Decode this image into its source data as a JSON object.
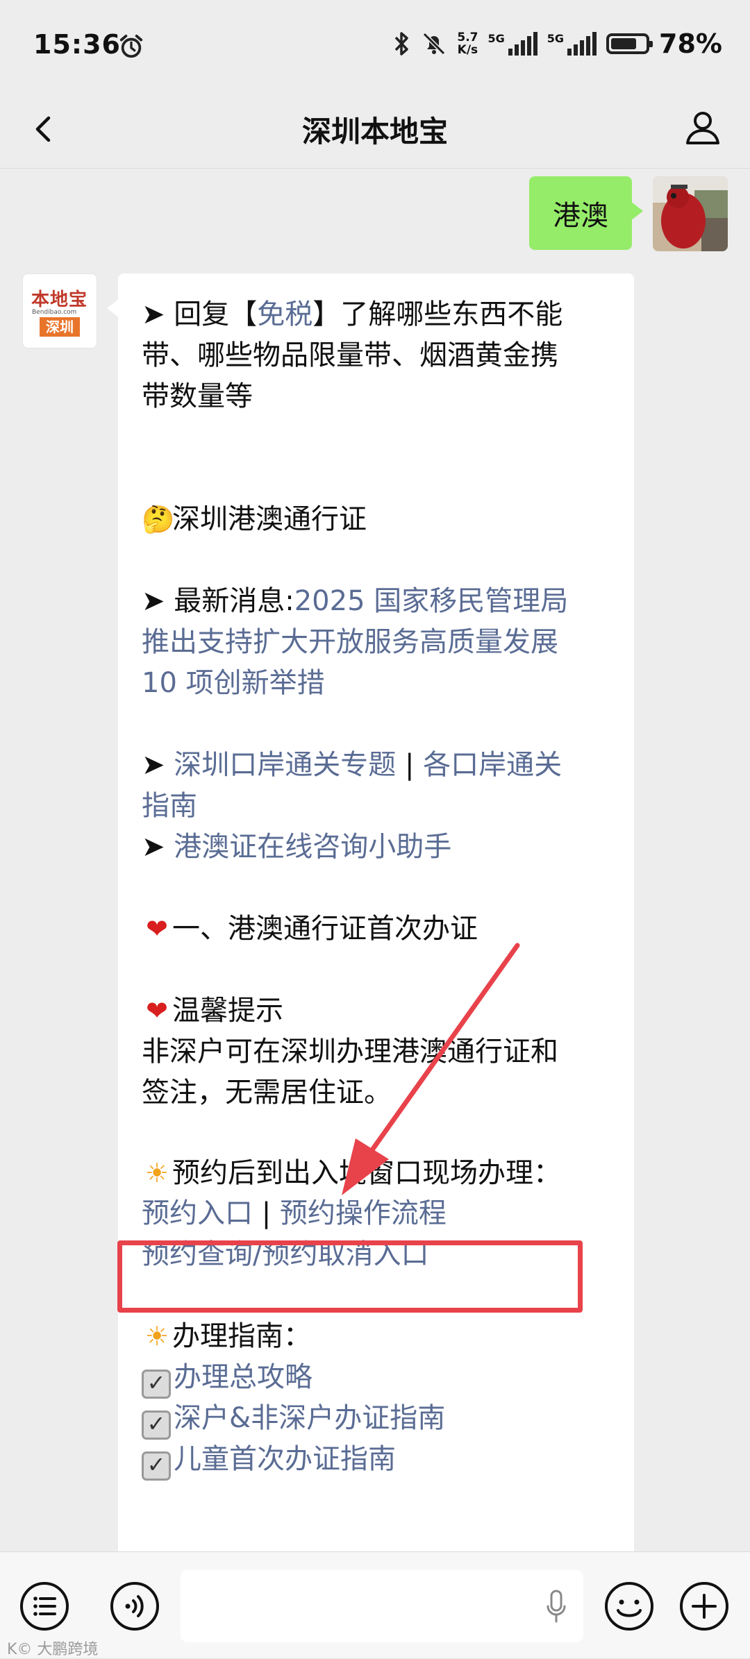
{
  "status_bar": {
    "time": "15:36",
    "speed_value": "5.7",
    "speed_unit": "K/s",
    "network_1": "5G",
    "network_2": "5G",
    "battery_percent": "78%",
    "battery_level": 0.78
  },
  "header": {
    "title": "深圳本地宝"
  },
  "outgoing_message": {
    "text": "港澳"
  },
  "sender_logo": {
    "top_text": "本地宝",
    "site_text": "Bendibao.com",
    "city_text": "深圳"
  },
  "message": {
    "l1_pre": "➤ 回复【",
    "l1_link": "免税",
    "l1_post": "】了解哪些东西不能",
    "l2": "带、哪些物品限量带、烟酒黄金携",
    "l3": "带数量等",
    "l4": "深圳港澳通行证",
    "l5_pre": "➤ 最新消息:",
    "l5_link": "2025 国家移民管理局",
    "l6": "推出支持扩大开放服务高质量发展",
    "l7": "10 项创新举措",
    "l8_pre": "➤ ",
    "l8_link1": "深圳口岸通关专题",
    "l8_sep": " | ",
    "l8_link2": "各口岸通关",
    "l9": "指南",
    "l10_pre": "➤ ",
    "l10_link": "港澳证在线咨询小助手",
    "l11": "一、港澳通行证首次办证",
    "l12": "温馨提示",
    "l13": "非深户可在深圳办理港澳通行证和",
    "l14": "签注，无需居住证。",
    "l15": "预约后到出入境窗口现场办理：",
    "l16_link1": "预约入口",
    "l16_sep": " | ",
    "l16_link2": "预约操作流程",
    "l17": "预约查询/预约取消入口",
    "l18": "办理指南：",
    "l19": "办理总攻略",
    "l20": "深户&非深户办证指南",
    "l21": "儿童首次办证指南"
  },
  "watermark": "K© 大鹏跨境",
  "colors": {
    "link": "#5a6c94",
    "outgoing_bubble": "#95ec69",
    "annotation_red": "#e8424b"
  }
}
